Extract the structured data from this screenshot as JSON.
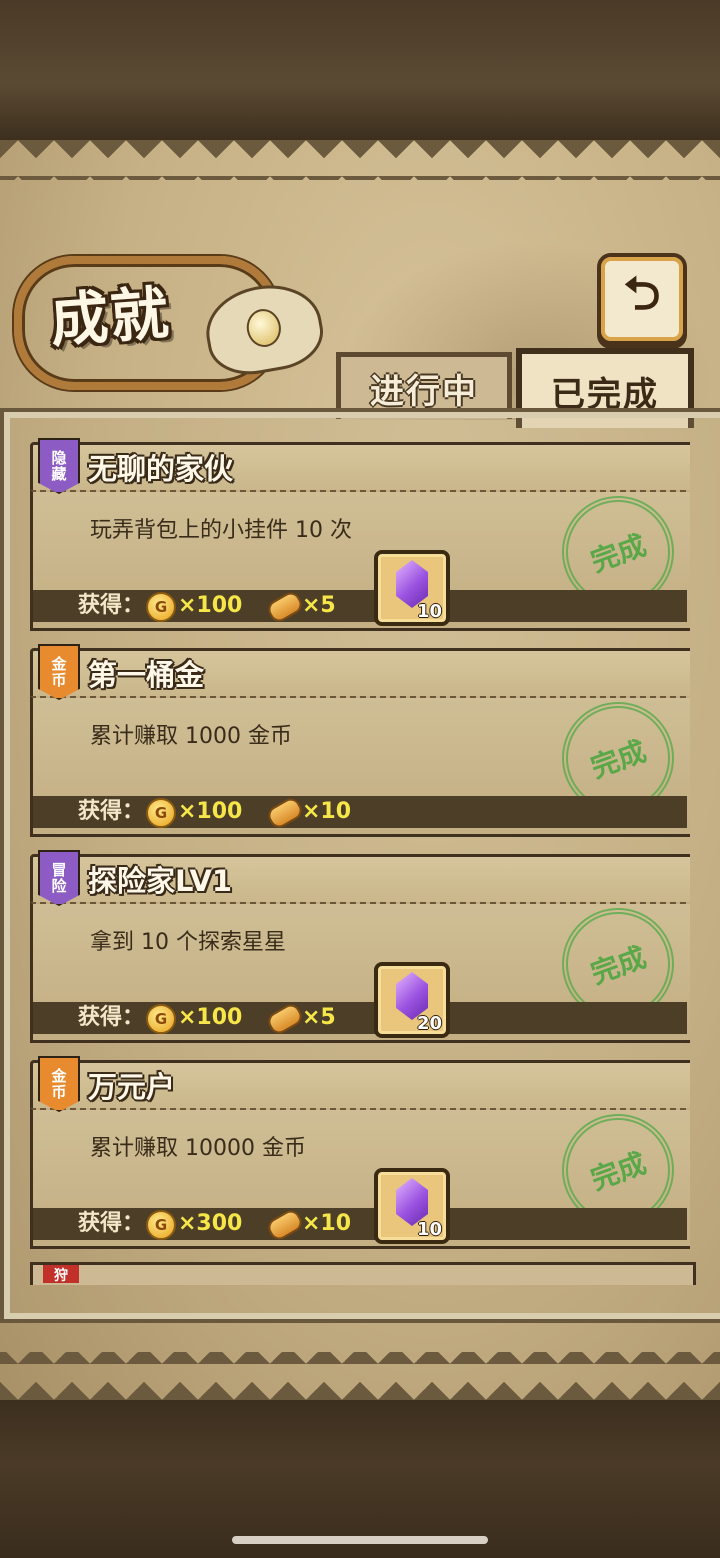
{
  "header": {
    "title": "成就",
    "back_icon": "⮌"
  },
  "tabs": [
    {
      "label": "进行中",
      "selected": false
    },
    {
      "label": "已完成",
      "selected": true
    }
  ],
  "achievements": [
    {
      "category": "隐\n藏",
      "category_color": "#8c5cc4",
      "title": "无聊的家伙",
      "description": "玩弄背包上的小挂件 10 次",
      "reward_label": "获得：",
      "coin_icon": "G",
      "coins": "×100",
      "bread": "×5",
      "gem": "10",
      "stamp": "完成"
    },
    {
      "category": "金\n币",
      "category_color": "#e88a2e",
      "title": "第一桶金",
      "description": "累计赚取 1000 金币",
      "reward_label": "获得：",
      "coin_icon": "G",
      "coins": "×100",
      "bread": "×10",
      "gem": null,
      "stamp": "完成"
    },
    {
      "category": "冒\n险",
      "category_color": "#8c5cc4",
      "title": "探险家LV1",
      "description": "拿到 10 个探索星星",
      "reward_label": "获得：",
      "coin_icon": "G",
      "coins": "×100",
      "bread": "×5",
      "gem": "20",
      "stamp": "完成"
    },
    {
      "category": "金\n币",
      "category_color": "#e88a2e",
      "title": "万元户",
      "description": "累计赚取 10000 金币",
      "reward_label": "获得：",
      "coin_icon": "G",
      "coins": "×300",
      "bread": "×10",
      "gem": "10",
      "stamp": "完成"
    }
  ],
  "peek": {
    "category": "狩"
  }
}
